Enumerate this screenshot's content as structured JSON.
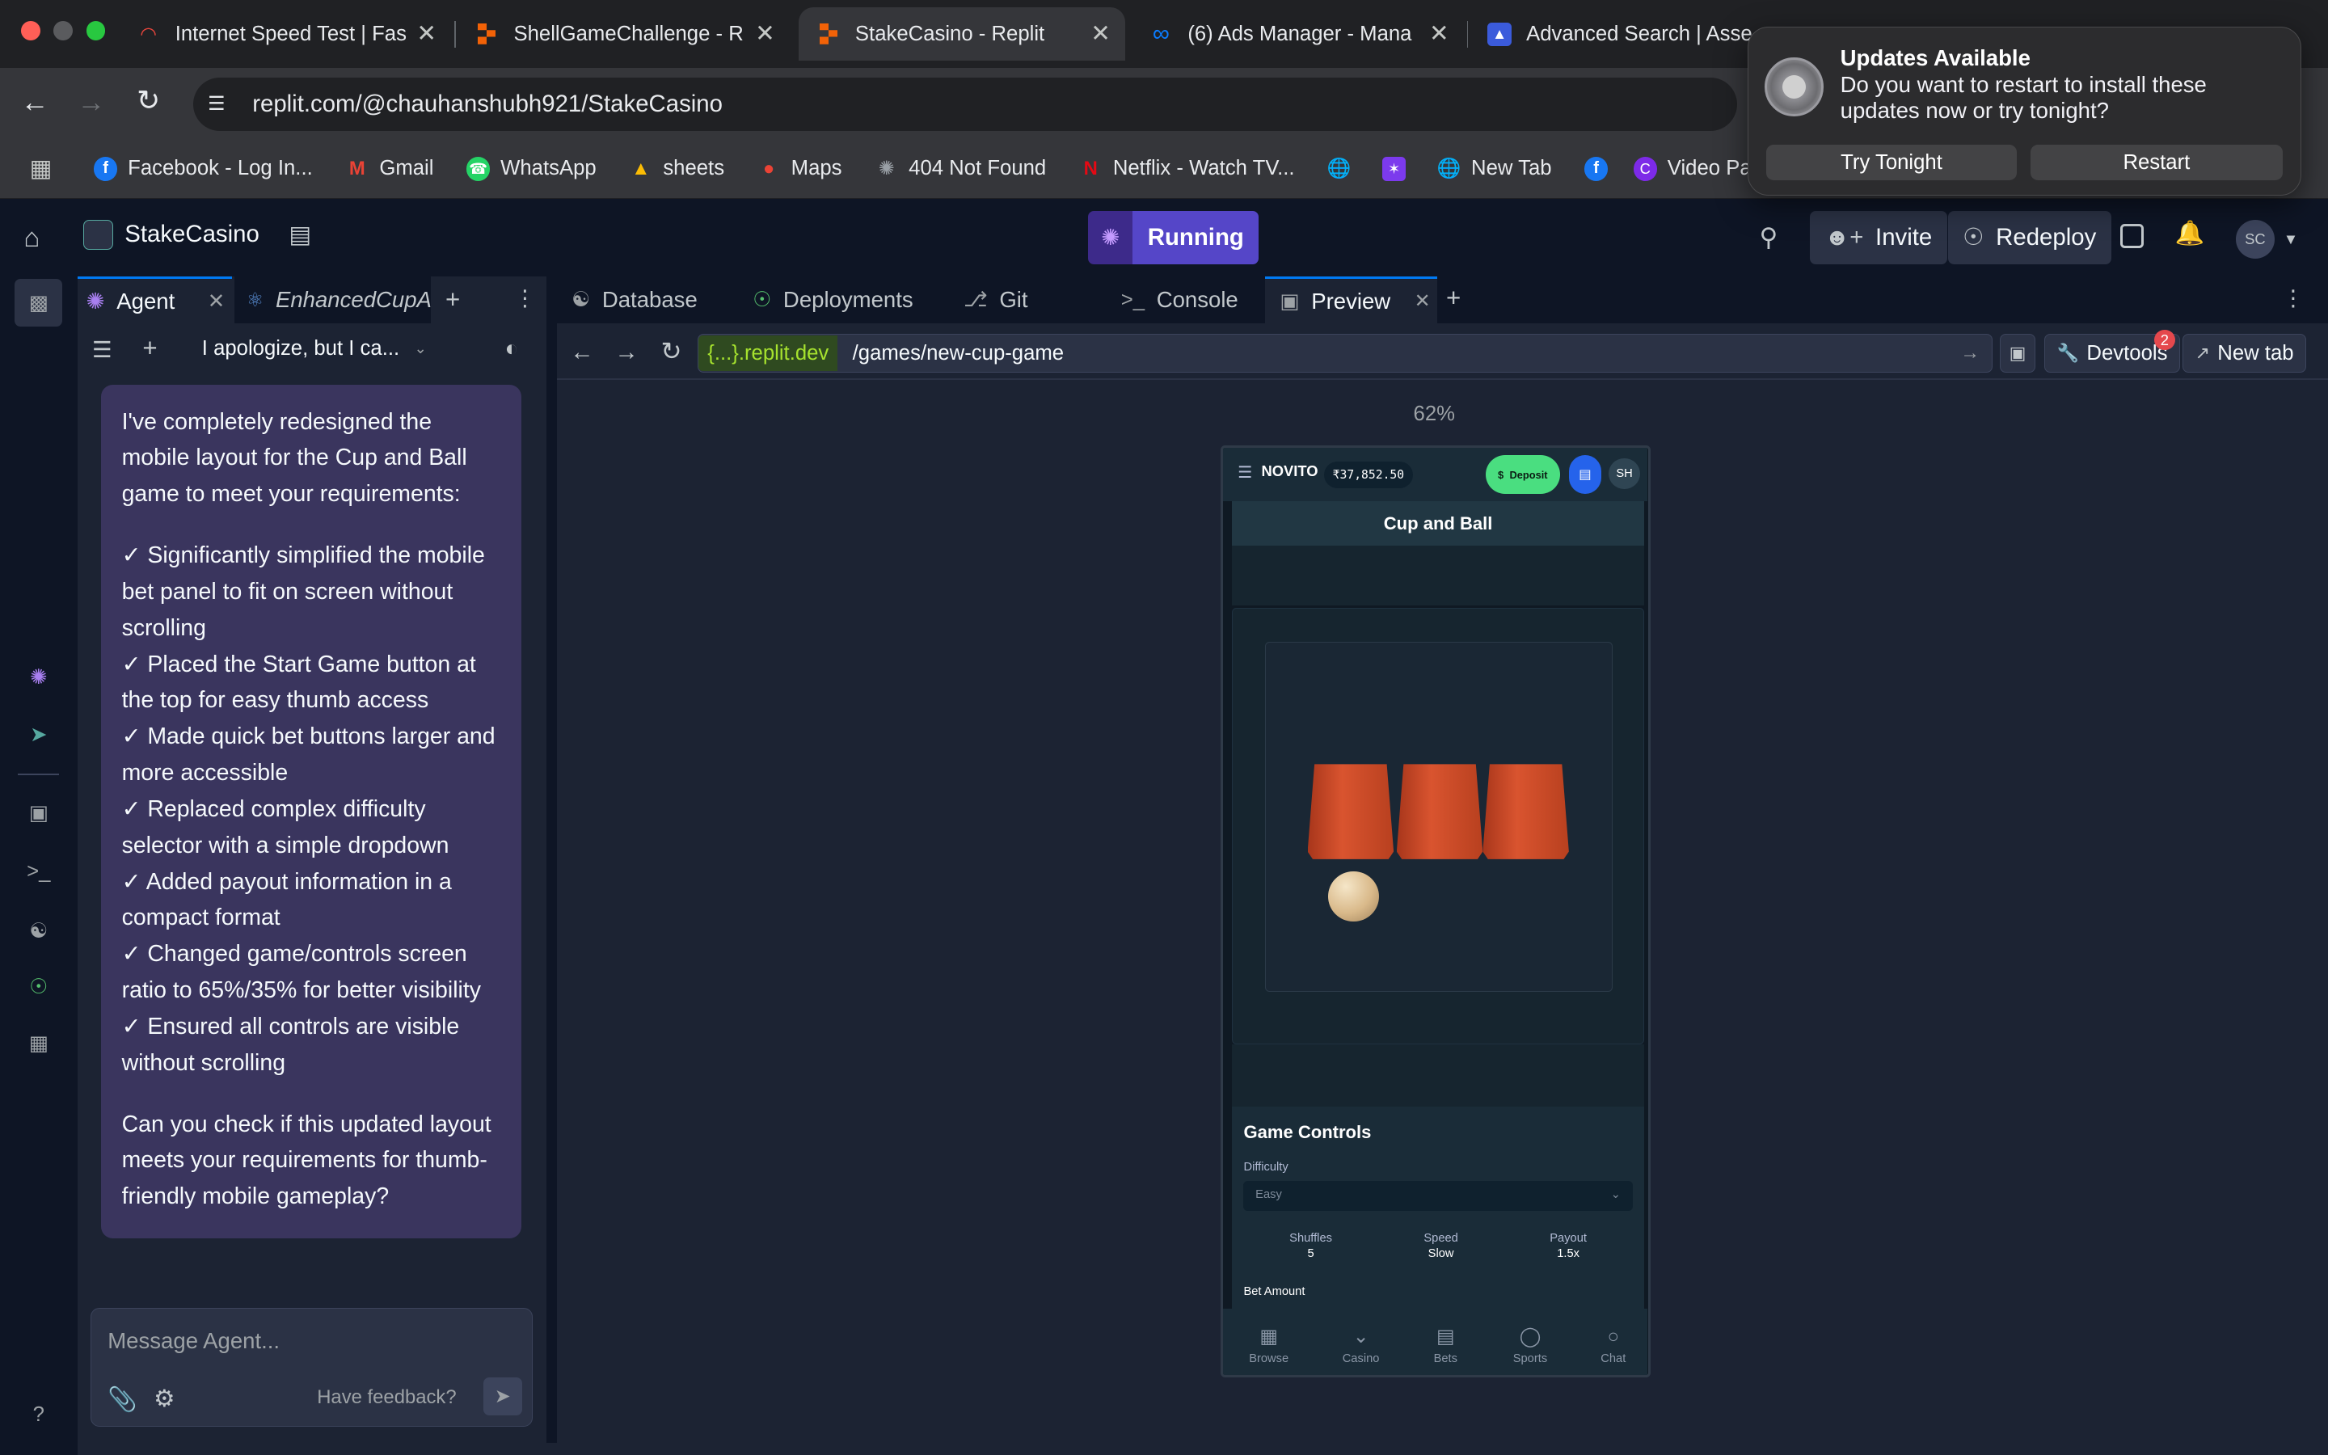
{
  "browser": {
    "tabs": [
      {
        "title": "Internet Speed Test | Fas",
        "icon": "speedometer-icon"
      },
      {
        "title": "ShellGameChallenge - R",
        "icon": "replit-icon"
      },
      {
        "title": "StakeCasino - Replit",
        "icon": "replit-icon",
        "active": true
      },
      {
        "title": "(6) Ads Manager - Mana",
        "icon": "meta-icon"
      },
      {
        "title": "Advanced Search | Asse",
        "icon": "asset-icon"
      }
    ],
    "url": "replit.com/@chauhanshubh921/StakeCasino",
    "bookmarks": [
      {
        "label": "Facebook - Log In...",
        "icon": "facebook-icon",
        "color": "#1877f2"
      },
      {
        "label": "Gmail",
        "icon": "gmail-icon",
        "color": "#ea4335"
      },
      {
        "label": "WhatsApp",
        "icon": "whatsapp-icon",
        "color": "#25d366"
      },
      {
        "label": "sheets",
        "icon": "drive-icon",
        "color": "#fbbc04"
      },
      {
        "label": "Maps",
        "icon": "maps-icon",
        "color": "#34a853"
      },
      {
        "label": "404 Not Found",
        "icon": "replit-icon",
        "color": "#0ea5e9"
      },
      {
        "label": "Netflix - Watch TV...",
        "icon": "netflix-icon",
        "color": "#e50914"
      },
      {
        "label": "New Tab",
        "icon": "globe-icon",
        "color": "#9aa0a6"
      },
      {
        "label": "Video Panch",
        "icon": "canva-icon",
        "color": "#7d2ae8"
      }
    ]
  },
  "notification": {
    "title": "Updates Available",
    "body": "Do you want to restart to install these updates now or try tonight?",
    "secondary": "Try Tonight",
    "primary": "Restart"
  },
  "replit": {
    "project": "StakeCasino",
    "status": "Running",
    "invite": "Invite",
    "redeploy": "Redeploy",
    "avatar": "SC",
    "agent_tabs": [
      "Agent",
      "EnhancedCupAr"
    ],
    "chat_title": "I apologize, but I ca...",
    "message_intro": "I've completely redesigned the mobile layout for the Cup and Ball game to meet your requirements:",
    "message_points": [
      "✓ Significantly simplified the mobile bet panel to fit on screen without scrolling",
      "✓ Placed the Start Game button at the top for easy thumb access",
      "✓ Made quick bet buttons larger and more accessible",
      "✓ Replaced complex difficulty selector with a simple dropdown",
      "✓ Added payout information in a compact format",
      "✓ Changed game/controls screen ratio to 65%/35% for better visibility",
      "✓ Ensured all controls are visible without scrolling"
    ],
    "message_outro": "Can you check if this updated layout meets your requirements for thumb-friendly mobile gameplay?",
    "input_placeholder": "Message Agent...",
    "feedback": "Have feedback?",
    "workspace_tabs": [
      "Database",
      "Deployments",
      "Git",
      "Console",
      "Preview"
    ],
    "preview_domain": "{...}.replit.dev",
    "preview_path": "/games/new-cup-game",
    "devtools": "Devtools",
    "devtools_badge": "2",
    "new_tab": "New tab",
    "zoom": "62%"
  },
  "game": {
    "brand": "NOVITO",
    "balance": "₹37,852.50",
    "deposit": "Deposit",
    "user": "SH",
    "title": "Cup and Ball",
    "controls_title": "Game Controls",
    "difficulty_label": "Difficulty",
    "difficulty_value": "Easy",
    "stats": [
      {
        "label": "Shuffles",
        "value": "5"
      },
      {
        "label": "Speed",
        "value": "Slow"
      },
      {
        "label": "Payout",
        "value": "1.5x"
      }
    ],
    "bet_label": "Bet Amount",
    "nav": [
      "Browse",
      "Casino",
      "Bets",
      "Sports",
      "Chat"
    ]
  }
}
